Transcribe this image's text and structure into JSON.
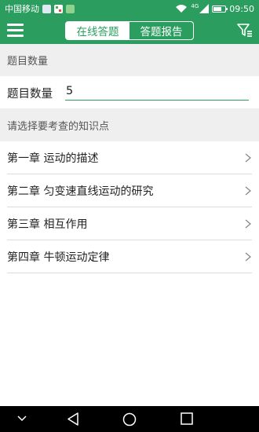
{
  "status_bar": {
    "carrier": "中国移动",
    "network": "4G",
    "time": "09:50"
  },
  "app_bar": {
    "menu_icon": "hamburger-menu-icon",
    "tabs": [
      {
        "label": "在线答题",
        "active": true
      },
      {
        "label": "答题报告",
        "active": false
      }
    ],
    "filter_icon": "filter-icon"
  },
  "question_count_section": {
    "header": "题目数量",
    "field_label": "题目数量",
    "field_value": "5"
  },
  "knowledge_section": {
    "header": "请选择要考查的知识点",
    "chapters": [
      {
        "label": "第一章 运动的描述"
      },
      {
        "label": "第二章 匀变速直线运动的研究"
      },
      {
        "label": "第三章 相互作用"
      },
      {
        "label": "第四章 牛顿运动定律"
      }
    ]
  },
  "colors": {
    "brand_green": "#2a9d5f",
    "section_background": "#efefef",
    "divider": "#dcdcdc"
  },
  "nav_bar": {
    "icons": [
      "chevron-down-icon",
      "back-triangle-icon",
      "home-circle-icon",
      "recent-square-icon"
    ]
  }
}
